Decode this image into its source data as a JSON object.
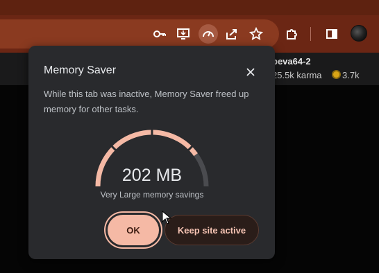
{
  "browser": {
    "toolbar_icons": [
      "key-icon",
      "install-app-icon",
      "memory-saver-icon",
      "share-icon",
      "bookmark-star-icon",
      "extensions-icon",
      "side-panel-icon"
    ],
    "colors": {
      "toolbar": "#6b2614",
      "omnibox": "#8a3a20",
      "accent": "#f5b9a5"
    }
  },
  "page": {
    "username": "peva64-2",
    "karma": "25.5k karma",
    "coins": "3.7k"
  },
  "popup": {
    "title": "Memory Saver",
    "description": "While this tab was inactive, Memory Saver freed up memory for other tasks.",
    "gauge": {
      "value": "202 MB",
      "label": "Very Large memory savings",
      "level": 0.8
    },
    "ok_label": "OK",
    "keep_active_label": "Keep site active"
  }
}
